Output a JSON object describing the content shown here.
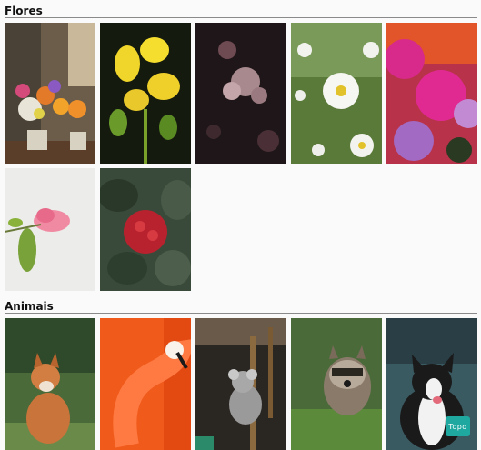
{
  "sections": [
    {
      "title": "Flores",
      "photos": [
        {
          "icon": "flower-bouquet-photo"
        },
        {
          "icon": "yellow-flowers-photo"
        },
        {
          "icon": "dark-pink-blossoms-photo"
        },
        {
          "icon": "daisies-photo"
        },
        {
          "icon": "roses-photo"
        },
        {
          "icon": "hibiscus-photo"
        },
        {
          "icon": "red-ixora-photo"
        }
      ]
    },
    {
      "title": "Animais",
      "photos": [
        {
          "icon": "fox-photo"
        },
        {
          "icon": "flamingo-photo"
        },
        {
          "icon": "koala-photo"
        },
        {
          "icon": "raccoon-photo"
        },
        {
          "icon": "border-collie-photo"
        }
      ]
    }
  ],
  "top_button": {
    "label": "Topo"
  }
}
